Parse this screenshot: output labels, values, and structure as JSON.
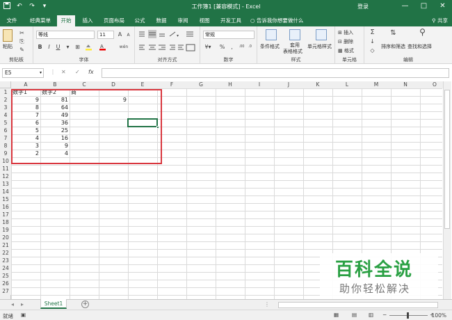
{
  "app": {
    "title": "工作簿1 [兼容模式] - Excel",
    "login": "登录",
    "window_buttons": [
      "—",
      "□",
      "✕"
    ],
    "quick_access": [
      "save-icon",
      "undo-icon",
      "redo-icon",
      "customize-icon"
    ]
  },
  "tabs": [
    "文件",
    "经典菜单",
    "开始",
    "插入",
    "页面布局",
    "公式",
    "数据",
    "审阅",
    "视图",
    "开发工具"
  ],
  "active_tab": "开始",
  "tell_me": "告诉我你想要做什么",
  "share": "共享",
  "ribbon": {
    "clipboard": {
      "paste": "粘贴",
      "label": "剪贴板"
    },
    "font": {
      "name": "等线",
      "size": "11",
      "grow": "A",
      "shrink": "A",
      "bold": "B",
      "italic": "I",
      "underline": "U",
      "label": "字体",
      "wen": "wén"
    },
    "alignment": {
      "label": "对齐方式"
    },
    "number": {
      "format": "常规",
      "percent": "%",
      "comma": ",",
      "label": "数字"
    },
    "styles": {
      "conditional": "条件格式",
      "table_line1": "套用",
      "table_line2": "表格格式",
      "cell_styles": "单元格样式",
      "label": "样式"
    },
    "cells": {
      "insert": "插入",
      "delete": "删除",
      "format": "格式",
      "label": "单元格"
    },
    "editing": {
      "sum": "Σ",
      "sort": "排序和筛选",
      "find": "查找和选择",
      "label": "编辑"
    }
  },
  "formula_bar": {
    "name_box": "E5",
    "cancel": "✕",
    "enter": "✓",
    "fx": "fx",
    "formula": ""
  },
  "columns": [
    "A",
    "B",
    "C",
    "D",
    "E",
    "F",
    "G",
    "H",
    "I",
    "J",
    "K",
    "L",
    "M",
    "N",
    "O"
  ],
  "rows": [
    "1",
    "2",
    "3",
    "4",
    "5",
    "6",
    "7",
    "8",
    "9",
    "10",
    "11",
    "12",
    "13",
    "14",
    "15",
    "16",
    "17",
    "18",
    "19",
    "20",
    "21",
    "22",
    "23",
    "24",
    "25",
    "26",
    "27"
  ],
  "cells": [
    {
      "ref": "A1",
      "value": "数字1",
      "num": false
    },
    {
      "ref": "B1",
      "value": "数字2",
      "num": false
    },
    {
      "ref": "C1",
      "value": "商",
      "num": false
    },
    {
      "ref": "A2",
      "value": "9",
      "num": true
    },
    {
      "ref": "B2",
      "value": "81",
      "num": true
    },
    {
      "ref": "D2",
      "value": "9",
      "num": true
    },
    {
      "ref": "A3",
      "value": "8",
      "num": true
    },
    {
      "ref": "B3",
      "value": "64",
      "num": true
    },
    {
      "ref": "A4",
      "value": "7",
      "num": true
    },
    {
      "ref": "B4",
      "value": "49",
      "num": true
    },
    {
      "ref": "A5",
      "value": "6",
      "num": true
    },
    {
      "ref": "B5",
      "value": "36",
      "num": true
    },
    {
      "ref": "A6",
      "value": "5",
      "num": true
    },
    {
      "ref": "B6",
      "value": "25",
      "num": true
    },
    {
      "ref": "A7",
      "value": "4",
      "num": true
    },
    {
      "ref": "B7",
      "value": "16",
      "num": true
    },
    {
      "ref": "A8",
      "value": "3",
      "num": true
    },
    {
      "ref": "B8",
      "value": "9",
      "num": true
    },
    {
      "ref": "A9",
      "value": "2",
      "num": true
    },
    {
      "ref": "B9",
      "value": "4",
      "num": true
    }
  ],
  "selected_cell": "E5",
  "sheets": [
    "Sheet1"
  ],
  "status": {
    "ready": "就绪",
    "zoom": "100%"
  },
  "watermark": {
    "big": "百科全说",
    "small": "助你轻松解决"
  },
  "colors": {
    "excel_green": "#217346",
    "highlight_red": "#d9363e",
    "watermark_green": "#2aa043"
  }
}
